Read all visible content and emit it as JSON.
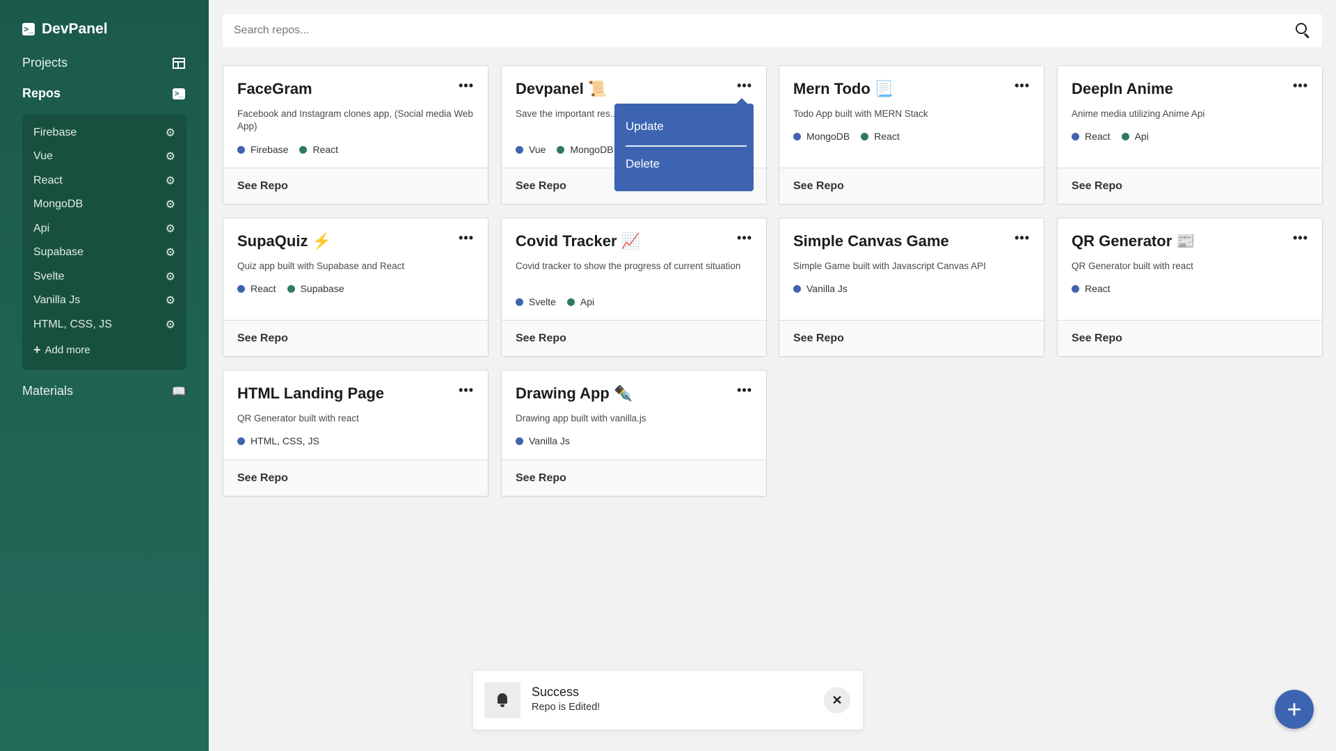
{
  "colors": {
    "sidebar": "#1b5a4b",
    "accent": "#3c64b1",
    "tag_blue": "#3f63ae",
    "tag_green": "#2f7a66"
  },
  "brand": {
    "name": "DevPanel"
  },
  "nav": [
    {
      "label": "Projects",
      "icon": "layout-icon"
    },
    {
      "label": "Repos",
      "icon": "terminal-icon"
    },
    {
      "label": "Materials",
      "icon": "book-icon"
    }
  ],
  "repo_filters": [
    "Firebase",
    "Vue",
    "React",
    "MongoDB",
    "Api",
    "Supabase",
    "Svelte",
    "Vanilla Js",
    "HTML, CSS, JS"
  ],
  "add_more": "Add more",
  "search": {
    "placeholder": "Search repos..."
  },
  "cards": [
    {
      "title": "FaceGram",
      "desc": "Facebook and Instagram clones app, (Social media Web App)",
      "tags": [
        "Firebase",
        "React"
      ],
      "footer": "See Repo"
    },
    {
      "title": "Devpanel 📜",
      "desc": "Save the important res... journey.",
      "tags": [
        "Vue",
        "MongoDB"
      ],
      "footer": "See Repo"
    },
    {
      "title": "Mern Todo 📃",
      "desc": "Todo App built with MERN Stack",
      "tags": [
        "MongoDB",
        "React"
      ],
      "footer": "See Repo"
    },
    {
      "title": "DeepIn Anime",
      "desc": "Anime media utilizing Anime Api",
      "tags": [
        "React",
        "Api"
      ],
      "footer": "See Repo"
    },
    {
      "title": "SupaQuiz ⚡",
      "desc": "Quiz app built with Supabase and React",
      "tags": [
        "React",
        "Supabase"
      ],
      "footer": "See Repo"
    },
    {
      "title": "Covid Tracker 📈",
      "desc": "Covid tracker to show the progress of current situation",
      "tags": [
        "Svelte",
        "Api"
      ],
      "footer": "See Repo"
    },
    {
      "title": "Simple Canvas Game",
      "desc": "Simple Game built with Javascript Canvas API",
      "tags": [
        "Vanilla Js"
      ],
      "footer": "See Repo"
    },
    {
      "title": "QR Generator 📰",
      "desc": "QR Generator built with react",
      "tags": [
        "React"
      ],
      "footer": "See Repo"
    },
    {
      "title": "HTML Landing Page",
      "desc": "QR Generator built with react",
      "tags": [
        "HTML, CSS, JS"
      ],
      "footer": "See Repo"
    },
    {
      "title": "Drawing App ✒️",
      "desc": "Drawing app built with vanilla.js",
      "tags": [
        "Vanilla Js"
      ],
      "footer": "See Repo"
    }
  ],
  "card_menu_icon": "ellipsis-icon",
  "dropdown": {
    "items": [
      "Update",
      "Delete"
    ]
  },
  "toast": {
    "title": "Success",
    "message": "Repo is Edited!",
    "close": "✕"
  },
  "fab": {
    "label": "+"
  }
}
